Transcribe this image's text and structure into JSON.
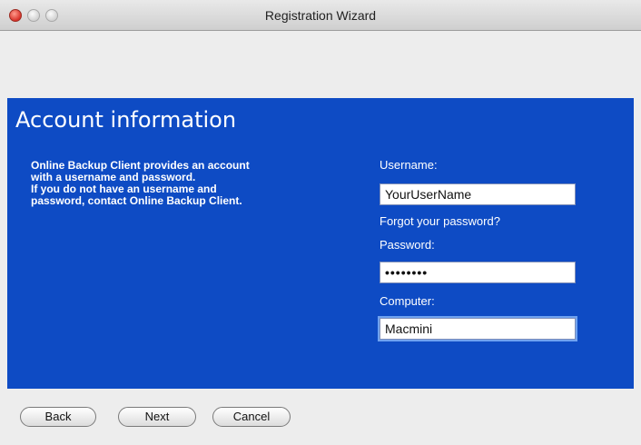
{
  "window": {
    "title": "Registration Wizard"
  },
  "panel": {
    "heading": "Account information",
    "description_lines": [
      "Online Backup Client provides an account",
      "with a username and password.",
      "If you do not have an username and",
      "password, contact Online Backup Client."
    ],
    "accent_color": "#0e4bc4"
  },
  "form": {
    "username_label": "Username:",
    "username_value": "YourUserName",
    "forgot_link": "Forgot your password?",
    "password_label": "Password:",
    "password_value": "••••••••",
    "computer_label": "Computer:",
    "computer_value": "Macmini"
  },
  "buttons": {
    "back": "Back",
    "next": "Next",
    "cancel": "Cancel"
  }
}
